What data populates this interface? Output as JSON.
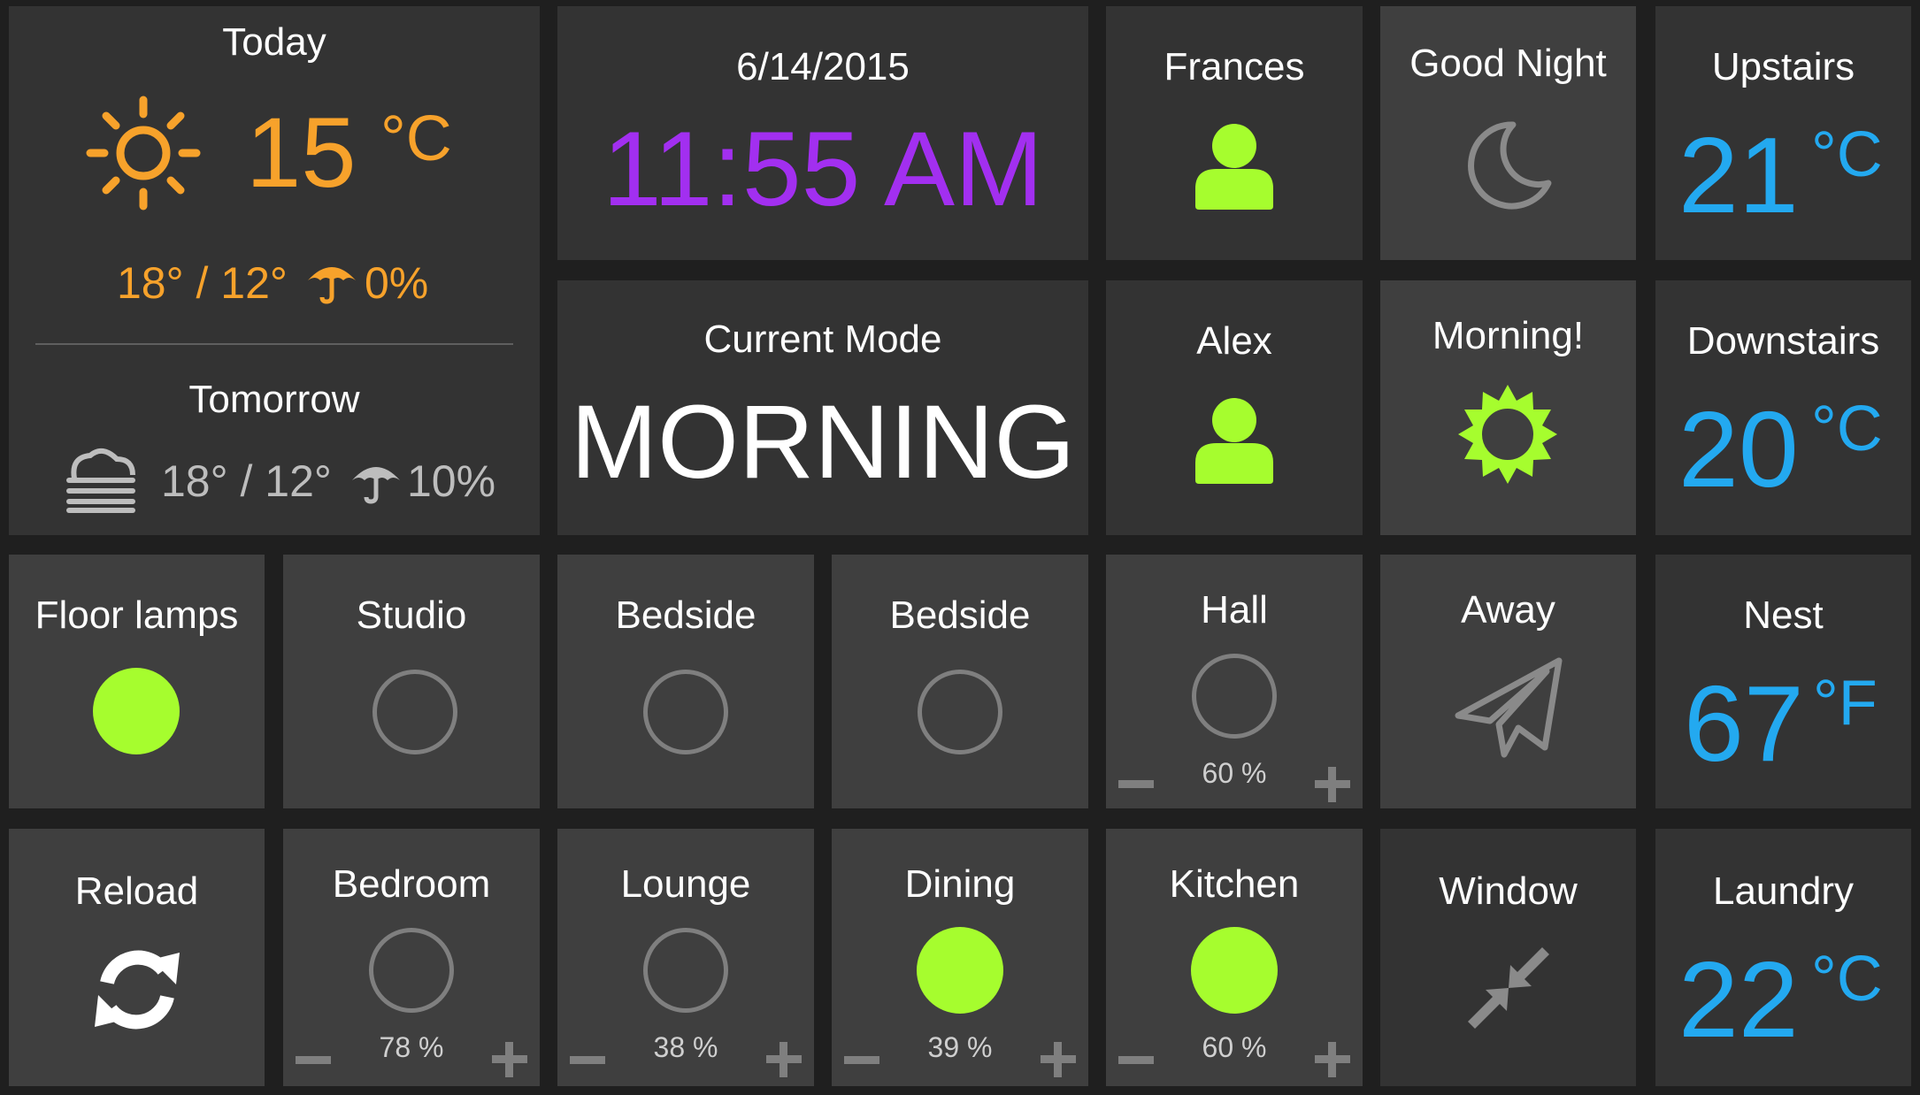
{
  "colors": {
    "accent_green": "#a6fd2e",
    "accent_orange": "#f7a22b",
    "accent_purple": "#a22ff0",
    "accent_blue": "#23a9f0",
    "tile_dark": "#333333",
    "tile_light": "#3f3f3f"
  },
  "weather": {
    "today_label": "Today",
    "today_icon": "sun-icon",
    "today_temp": "15",
    "today_unit": "°C",
    "today_hilo": "18° / 12°",
    "today_rain_icon": "umbrella-icon",
    "today_rain": "0%",
    "tomorrow_label": "Tomorrow",
    "tomorrow_icon": "fog-icon",
    "tomorrow_hilo": "18° / 12°",
    "tomorrow_rain_icon": "umbrella-icon",
    "tomorrow_rain": "10%"
  },
  "clock": {
    "date": "6/14/2015",
    "time": "11:55 AM"
  },
  "mode": {
    "label": "Current Mode",
    "value": "MORNING"
  },
  "people": [
    {
      "name": "Frances",
      "icon": "person-icon",
      "present": true
    },
    {
      "name": "Alex",
      "icon": "person-icon",
      "present": true
    }
  ],
  "scenes": {
    "good_night": {
      "label": "Good Night",
      "icon": "moon-icon"
    },
    "morning": {
      "label": "Morning!",
      "icon": "sun-icon"
    },
    "away": {
      "label": "Away",
      "icon": "paper-plane-icon"
    },
    "window": {
      "label": "Window",
      "icon": "compress-arrows-icon"
    }
  },
  "thermostats": {
    "upstairs": {
      "label": "Upstairs",
      "value": "21",
      "unit": "°C"
    },
    "downstairs": {
      "label": "Downstairs",
      "value": "20",
      "unit": "°C"
    },
    "nest": {
      "label": "Nest",
      "value": "67",
      "unit": "°F"
    },
    "laundry": {
      "label": "Laundry",
      "value": "22",
      "unit": "°C"
    }
  },
  "switches": {
    "floor_lamps": {
      "label": "Floor lamps",
      "on": true
    },
    "studio": {
      "label": "Studio",
      "on": false
    },
    "bedside_1": {
      "label": "Bedside",
      "on": false
    },
    "bedside_2": {
      "label": "Bedside",
      "on": false
    }
  },
  "dimmers": {
    "hall": {
      "label": "Hall",
      "on": false,
      "level": "60 %"
    },
    "bedroom": {
      "label": "Bedroom",
      "on": false,
      "level": "78 %"
    },
    "lounge": {
      "label": "Lounge",
      "on": false,
      "level": "38 %"
    },
    "dining": {
      "label": "Dining",
      "on": true,
      "level": "39 %"
    },
    "kitchen": {
      "label": "Kitchen",
      "on": true,
      "level": "60 %"
    }
  },
  "reload": {
    "label": "Reload",
    "icon": "reload-icon"
  }
}
